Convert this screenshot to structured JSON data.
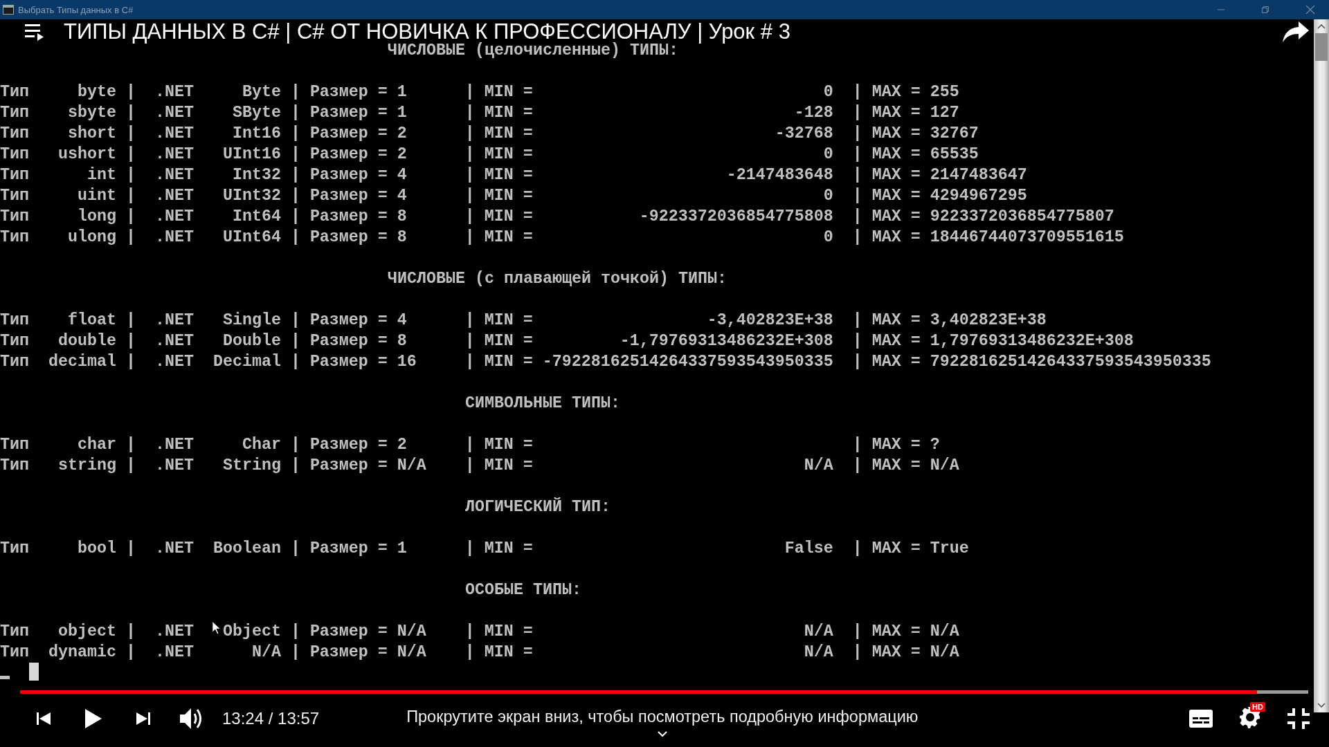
{
  "console_window": {
    "title": "Выбрать Типы данных в C#",
    "lines": [
      {
        "kind": "heading",
        "text": "\t\t\t\t\tЧИСЛОВЫЕ (целочисленные) ТИПЫ:"
      },
      {
        "kind": "blank"
      },
      {
        "kind": "row",
        "type_label": "Тип",
        "name": "byte",
        "sep1": "|",
        "net_label": ".NET",
        "net_type": "Byte",
        "sep2": "|",
        "size": "Размер = 1",
        "sep3": "|",
        "min_label": "MIN =",
        "min": "0",
        "sep4": "|",
        "max": "MAX = 255"
      },
      {
        "kind": "row",
        "type_label": "Тип",
        "name": "sbyte",
        "sep1": "|",
        "net_label": ".NET",
        "net_type": "SByte",
        "sep2": "|",
        "size": "Размер = 1",
        "sep3": "|",
        "min_label": "MIN =",
        "min": "-128",
        "sep4": "|",
        "max": "MAX = 127"
      },
      {
        "kind": "row",
        "type_label": "Тип",
        "name": "short",
        "sep1": "|",
        "net_label": ".NET",
        "net_type": "Int16",
        "sep2": "|",
        "size": "Размер = 2",
        "sep3": "|",
        "min_label": "MIN =",
        "min": "-32768",
        "sep4": "|",
        "max": "MAX = 32767"
      },
      {
        "kind": "row",
        "type_label": "Тип",
        "name": "ushort",
        "sep1": "|",
        "net_label": ".NET",
        "net_type": "UInt16",
        "sep2": "|",
        "size": "Размер = 2",
        "sep3": "|",
        "min_label": "MIN =",
        "min": "0",
        "sep4": "|",
        "max": "MAX = 65535"
      },
      {
        "kind": "row",
        "type_label": "Тип",
        "name": "int",
        "sep1": "|",
        "net_label": ".NET",
        "net_type": "Int32",
        "sep2": "|",
        "size": "Размер = 4",
        "sep3": "|",
        "min_label": "MIN =",
        "min": "-2147483648",
        "sep4": "|",
        "max": "MAX = 2147483647"
      },
      {
        "kind": "row",
        "type_label": "Тип",
        "name": "uint",
        "sep1": "|",
        "net_label": ".NET",
        "net_type": "UInt32",
        "sep2": "|",
        "size": "Размер = 4",
        "sep3": "|",
        "min_label": "MIN =",
        "min": "0",
        "sep4": "|",
        "max": "MAX = 4294967295"
      },
      {
        "kind": "row",
        "type_label": "Тип",
        "name": "long",
        "sep1": "|",
        "net_label": ".NET",
        "net_type": "Int64",
        "sep2": "|",
        "size": "Размер = 8",
        "sep3": "|",
        "min_label": "MIN =",
        "min": "-9223372036854775808",
        "sep4": "|",
        "max": "MAX = 9223372036854775807"
      },
      {
        "kind": "row",
        "type_label": "Тип",
        "name": "ulong",
        "sep1": "|",
        "net_label": ".NET",
        "net_type": "UInt64",
        "sep2": "|",
        "size": "Размер = 8",
        "sep3": "|",
        "min_label": "MIN =",
        "min": "0",
        "sep4": "|",
        "max": "MAX = 18446744073709551615"
      },
      {
        "kind": "blank"
      },
      {
        "kind": "heading",
        "text": "\t\t\t\t\tЧИСЛОВЫЕ (с плавающей точкой) ТИПЫ:"
      },
      {
        "kind": "blank"
      },
      {
        "kind": "row",
        "type_label": "Тип",
        "name": "float",
        "sep1": "|",
        "net_label": ".NET",
        "net_type": "Single",
        "sep2": "|",
        "size": "Размер = 4",
        "sep3": "|",
        "min_label": "MIN =",
        "min": "-3,402823E+38",
        "sep4": "|",
        "max": "MAX = 3,402823E+38"
      },
      {
        "kind": "row",
        "type_label": "Тип",
        "name": "double",
        "sep1": "|",
        "net_label": ".NET",
        "net_type": "Double",
        "sep2": "|",
        "size": "Размер = 8",
        "sep3": "|",
        "min_label": "MIN =",
        "min": "-1,79769313486232E+308",
        "sep4": "|",
        "max": "MAX = 1,79769313486232E+308"
      },
      {
        "kind": "row",
        "type_label": "Тип",
        "name": "decimal",
        "sep1": "|",
        "net_label": ".NET",
        "net_type": "Decimal",
        "sep2": "|",
        "size": "Размер = 16",
        "sep3": "|",
        "min_label": "MIN =",
        "min": "-79228162514264337593543950335",
        "sep4": "|",
        "max": "MAX = 79228162514264337593543950335"
      },
      {
        "kind": "blank"
      },
      {
        "kind": "heading",
        "text": "\t\t\t\t\t\tСИМВОЛЬНЫЕ ТИПЫ:"
      },
      {
        "kind": "blank"
      },
      {
        "kind": "row",
        "type_label": "Тип",
        "name": "char",
        "sep1": "|",
        "net_label": ".NET",
        "net_type": "Char",
        "sep2": "|",
        "size": "Размер = 2",
        "sep3": "|",
        "min_label": "MIN =",
        "sep4": "|",
        "max": "MAX = ?"
      },
      {
        "kind": "row",
        "type_label": "Тип",
        "name": "string",
        "sep1": "|",
        "net_label": ".NET",
        "net_type": "String",
        "sep2": "|",
        "size": "Размер = N/A",
        "sep3": "|",
        "min_label": "MIN =",
        "min": "N/A",
        "sep4": "|",
        "max": "MAX = N/A"
      },
      {
        "kind": "blank"
      },
      {
        "kind": "heading",
        "text": "\t\t\t\t\t\tЛОГИЧЕСКИЙ ТИП:"
      },
      {
        "kind": "blank"
      },
      {
        "kind": "row",
        "type_label": "Тип",
        "name": "bool",
        "sep1": "|",
        "net_label": ".NET",
        "net_type": "Boolean",
        "sep2": "|",
        "size": "Размер = 1",
        "sep3": "|",
        "min_label": "MIN =",
        "min": "False",
        "sep4": "|",
        "max": "MAX = True"
      },
      {
        "kind": "blank"
      },
      {
        "kind": "heading",
        "text": "\t\t\t\t\t\tОСОБЫЕ ТИПЫ:"
      },
      {
        "kind": "blank"
      },
      {
        "kind": "row",
        "type_label": "Тип",
        "name": "object",
        "sep1": "|",
        "net_label": ".NET",
        "net_type": "Object",
        "sep2": "|",
        "size": "Размер = N/A",
        "sep3": "|",
        "min_label": "MIN =",
        "min": "N/A",
        "sep4": "|",
        "max": "MAX = N/A"
      },
      {
        "kind": "row",
        "type_label": "Тип",
        "name": "dynamic",
        "sep1": "|",
        "net_label": ".NET",
        "net_type": "N/A",
        "sep2": "|",
        "size": "Размер = N/A",
        "sep3": "|",
        "min_label": "MIN =",
        "min": "N/A",
        "sep4": "|",
        "max": "MAX = N/A"
      },
      {
        "kind": "prompt"
      }
    ]
  },
  "video_player": {
    "title": "ТИПЫ ДАННЫХ В C# | C# ОТ НОВИЧКА К ПРОФЕССИОНАЛУ | Урок # 3",
    "progress": {
      "level": 0.96
    },
    "time": "13:24 / 13:57",
    "scroll_hint": "Прокрутите экран вниз, чтобы посмотреть подробную информацию",
    "quality_badge": "HD"
  }
}
